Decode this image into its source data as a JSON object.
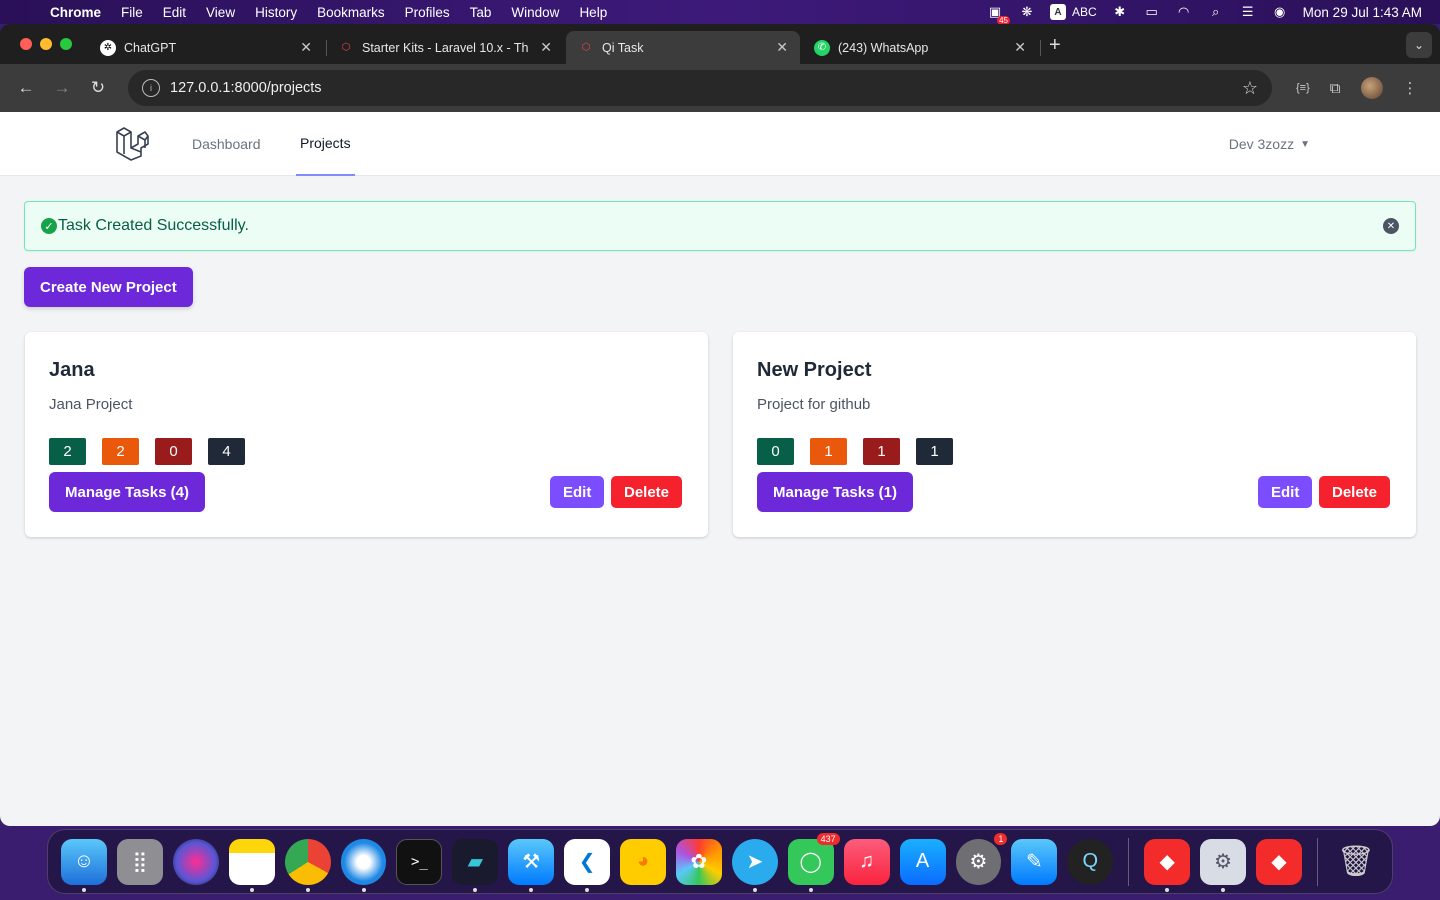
{
  "menubar": {
    "app": "Chrome",
    "items": [
      "File",
      "Edit",
      "View",
      "History",
      "Bookmarks",
      "Profiles",
      "Tab",
      "Window",
      "Help"
    ],
    "status_badge": "45",
    "input_source": "ABC",
    "clock": "Mon 29 Jul  1:43 AM"
  },
  "tabs": [
    {
      "title": "ChatGPT",
      "active": false
    },
    {
      "title": "Starter Kits - Laravel 10.x - Th",
      "active": false
    },
    {
      "title": "Qi Task",
      "active": true
    },
    {
      "title": "(243) WhatsApp",
      "active": false
    }
  ],
  "omnibox": {
    "url": "127.0.0.1:8000/projects"
  },
  "appnav": {
    "links": [
      "Dashboard",
      "Projects"
    ],
    "active": "Projects",
    "user": "Dev 3zozz"
  },
  "alert": {
    "message": "Task Created Successfully."
  },
  "create_button": "Create New Project",
  "projects": [
    {
      "name": "Jana",
      "description": "Jana Project",
      "counts": [
        "2",
        "2",
        "0",
        "4"
      ],
      "manage_label": "Manage Tasks (4)",
      "edit_label": "Edit",
      "delete_label": "Delete"
    },
    {
      "name": "New Project",
      "description": "Project for github",
      "counts": [
        "0",
        "1",
        "1",
        "1"
      ],
      "manage_label": "Manage Tasks (1)",
      "edit_label": "Edit",
      "delete_label": "Delete"
    }
  ],
  "dock": {
    "badges": {
      "messages": "437",
      "settings": "1"
    }
  },
  "colors": {
    "primary": "#6d28d9",
    "edit": "#7c4dff",
    "delete": "#f5222d",
    "count_green": "#065f46",
    "count_orange": "#ea580c",
    "count_red": "#991b1b",
    "count_dark": "#1f2937"
  }
}
